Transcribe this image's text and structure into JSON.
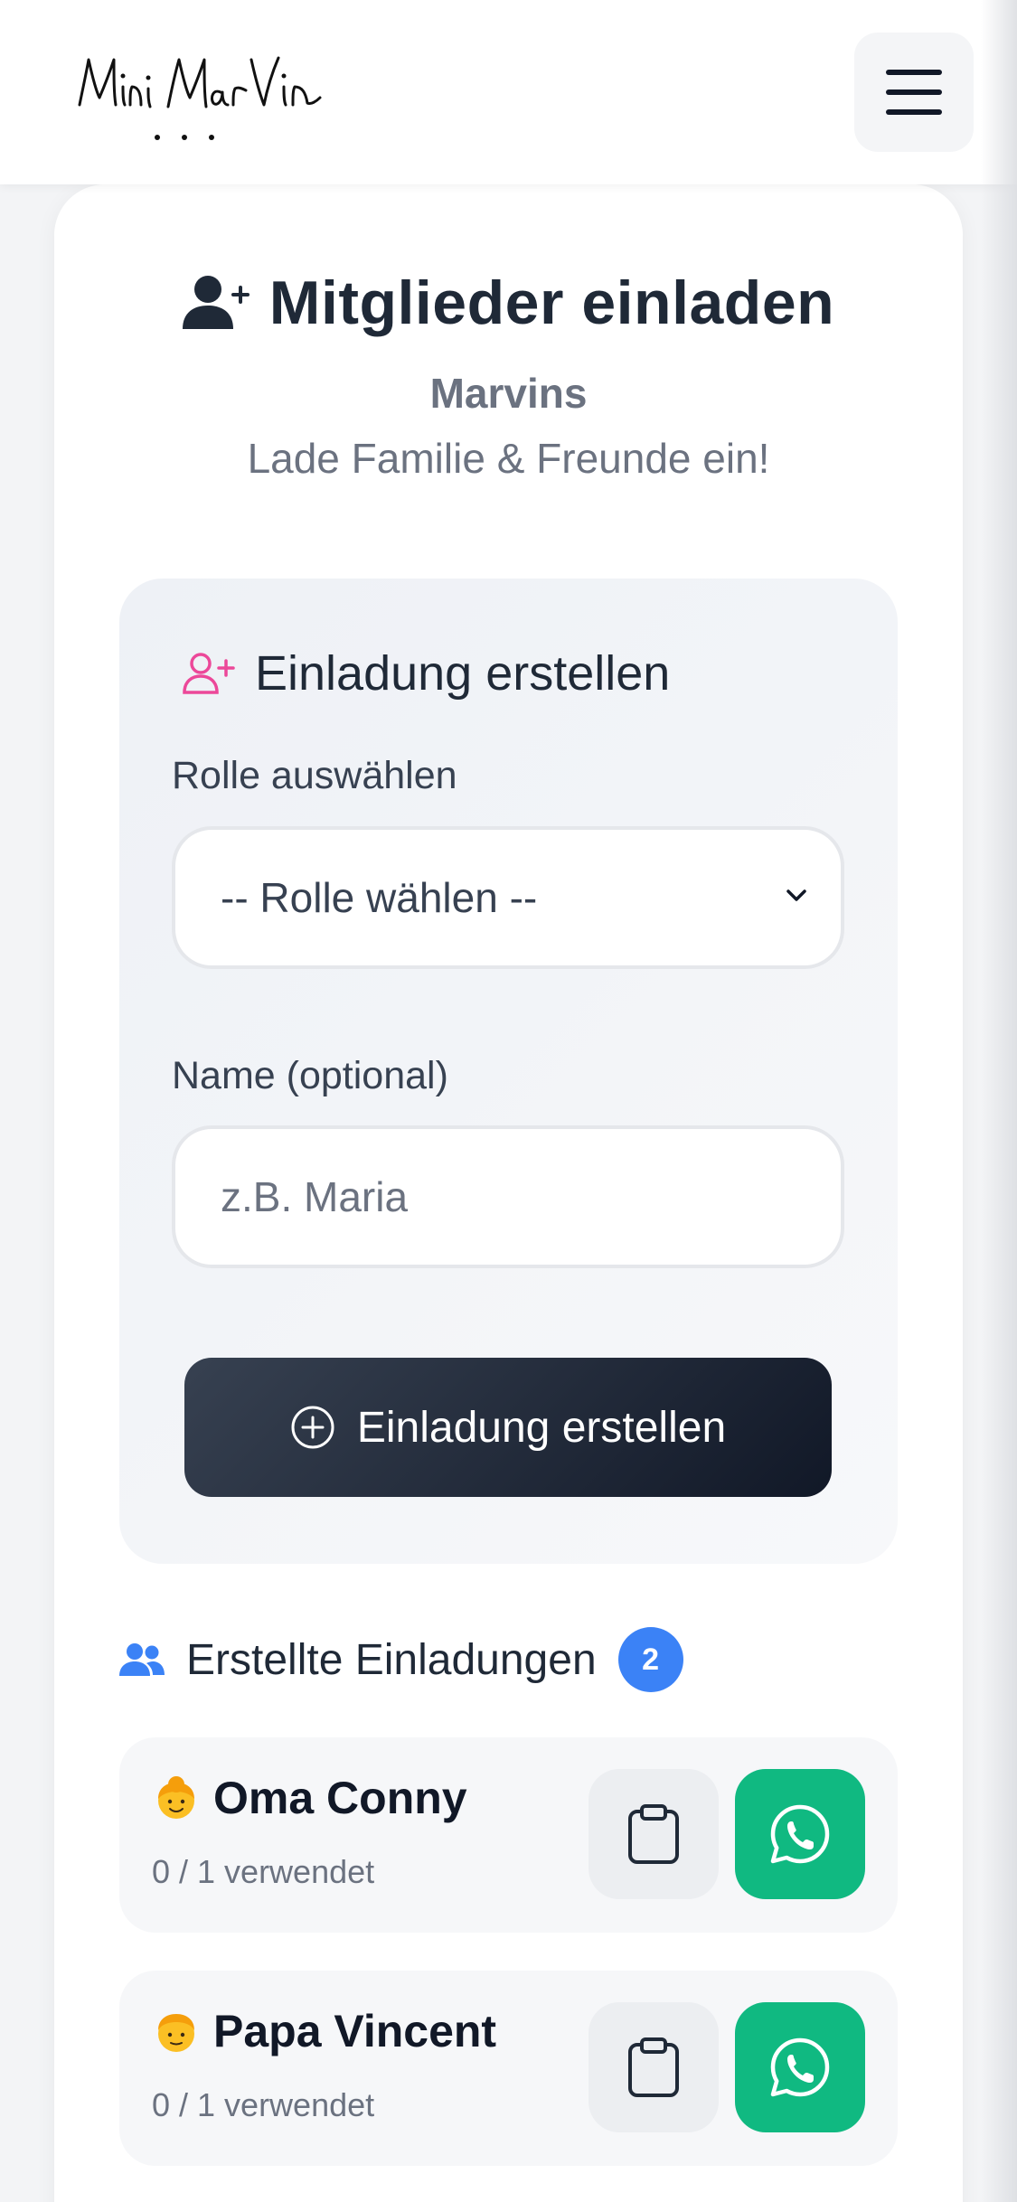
{
  "header": {
    "logo_text": "Mini MarVin",
    "menu_icon": "hamburger-menu-icon"
  },
  "page": {
    "title": "Mitglieder einladen",
    "title_icon": "user-plus-icon",
    "group_name": "Marvins",
    "tagline": "Lade Familie & Freunde ein!"
  },
  "form": {
    "heading": "Einladung erstellen",
    "heading_icon": "user-plus-outline-icon",
    "role_label": "Rolle auswählen",
    "role_selected": "-- Rolle wählen --",
    "name_label": "Name (optional)",
    "name_placeholder": "z.B. Maria",
    "name_value": "",
    "submit_label": "Einladung erstellen",
    "submit_icon": "plus-circle-icon"
  },
  "invitations": {
    "heading": "Erstellte Einladungen",
    "heading_icon": "users-icon",
    "count": "2",
    "items": [
      {
        "emoji": "grandmother-emoji",
        "name": "Oma Conny",
        "usage": "0 / 1 verwendet"
      },
      {
        "emoji": "man-emoji",
        "name": "Papa Vincent",
        "usage": "0 / 1 verwendet"
      }
    ]
  },
  "colors": {
    "accent_blue": "#3b82f6",
    "whatsapp_green": "#10b981",
    "pink_icon": "#ec4899",
    "dark_button": "#1f2937"
  }
}
